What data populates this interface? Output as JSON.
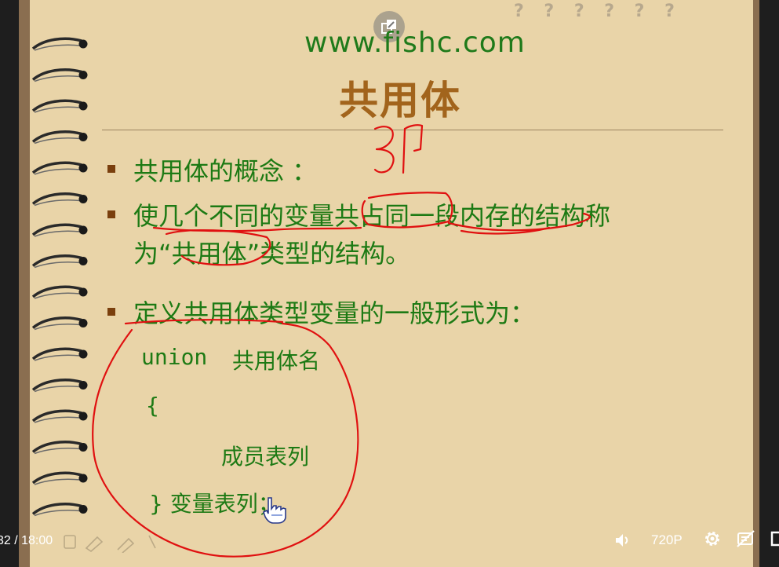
{
  "video": {
    "time_display": "32 / 18:00",
    "quality": "720P"
  },
  "slide": {
    "watermark": "? ? ? ? ? ?",
    "site": "www.fishc.com",
    "title": "共用体",
    "annotation_number": "31",
    "bullets": [
      "共用体的概念 ：",
      "使几个不同的变量共占同一段内存的结构称",
      "为“共用体”类型的结构。",
      "定义共用体类型变量的一般形式为："
    ],
    "code": {
      "line1_keyword": "union",
      "line1_name": "共用体名",
      "open_brace": "{",
      "members": "成员表列",
      "close": "} 变量表列；"
    }
  },
  "icons": {
    "popout": "popout-icon",
    "volume": "volume-icon",
    "settings": "gear-icon",
    "no_danmaku": "danmaku-off-icon",
    "pointer": "hand-pointer-icon"
  },
  "colors": {
    "paper": "#e9d4a8",
    "text_green": "#1d7a14",
    "title_orange": "#a2641c",
    "ink_red": "#e01010"
  }
}
